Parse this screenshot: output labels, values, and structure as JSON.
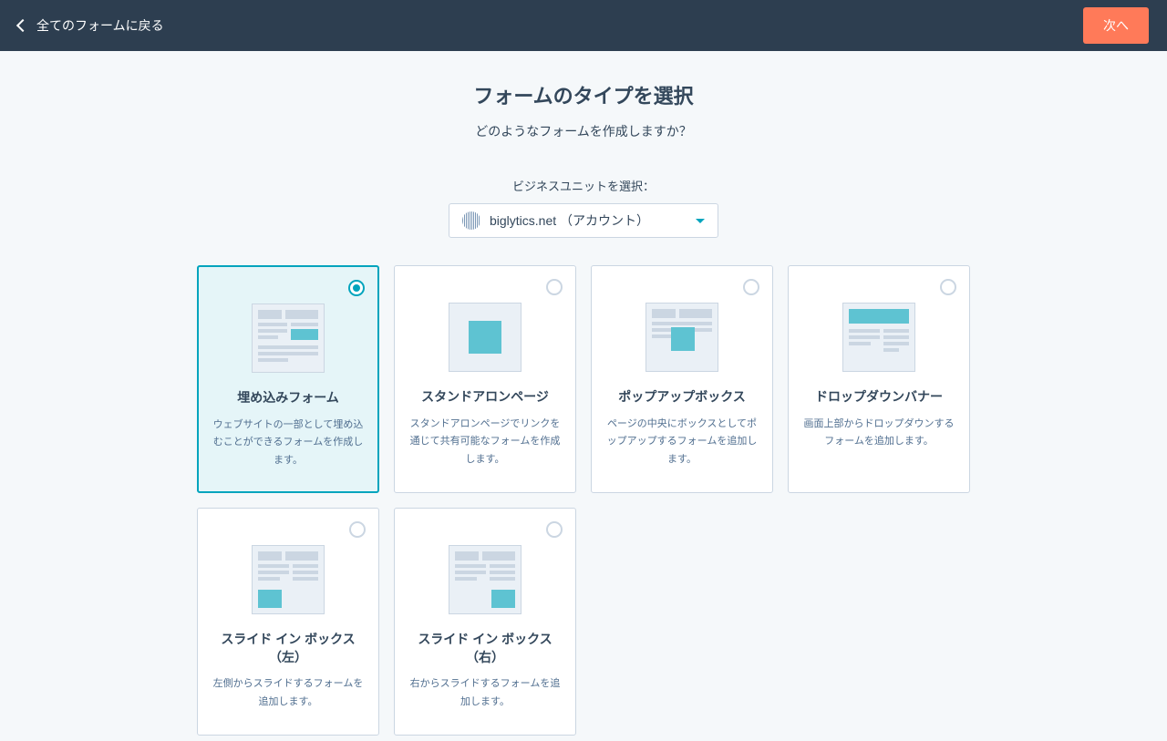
{
  "header": {
    "back_label": "全てのフォームに戻る",
    "next_label": "次へ"
  },
  "page": {
    "title": "フォームのタイプを選択",
    "subtitle": "どのようなフォームを作成しますか？"
  },
  "business_unit": {
    "label": "ビジネスユニットを選択：",
    "selected": "biglytics.net （アカウント）"
  },
  "form_types": [
    {
      "id": "embedded",
      "title": "埋め込みフォーム",
      "desc": "ウェブサイトの一部として埋め込むことができるフォームを作成します。",
      "selected": true
    },
    {
      "id": "standalone",
      "title": "スタンドアロンページ",
      "desc": "スタンドアロンページでリンクを通じて共有可能なフォームを作成します。",
      "selected": false
    },
    {
      "id": "popup",
      "title": "ポップアップボックス",
      "desc": "ページの中央にボックスとしてポップアップするフォームを追加します。",
      "selected": false
    },
    {
      "id": "dropdown-banner",
      "title": "ドロップダウンバナー",
      "desc": "画面上部からドロップダウンするフォームを追加します。",
      "selected": false
    },
    {
      "id": "slide-left",
      "title": "スライド イン ボックス（左）",
      "desc": "左側からスライドするフォームを追加します。",
      "selected": false
    },
    {
      "id": "slide-right",
      "title": "スライド イン ボックス（右）",
      "desc": "右からスライドするフォームを追加します。",
      "selected": false
    }
  ]
}
